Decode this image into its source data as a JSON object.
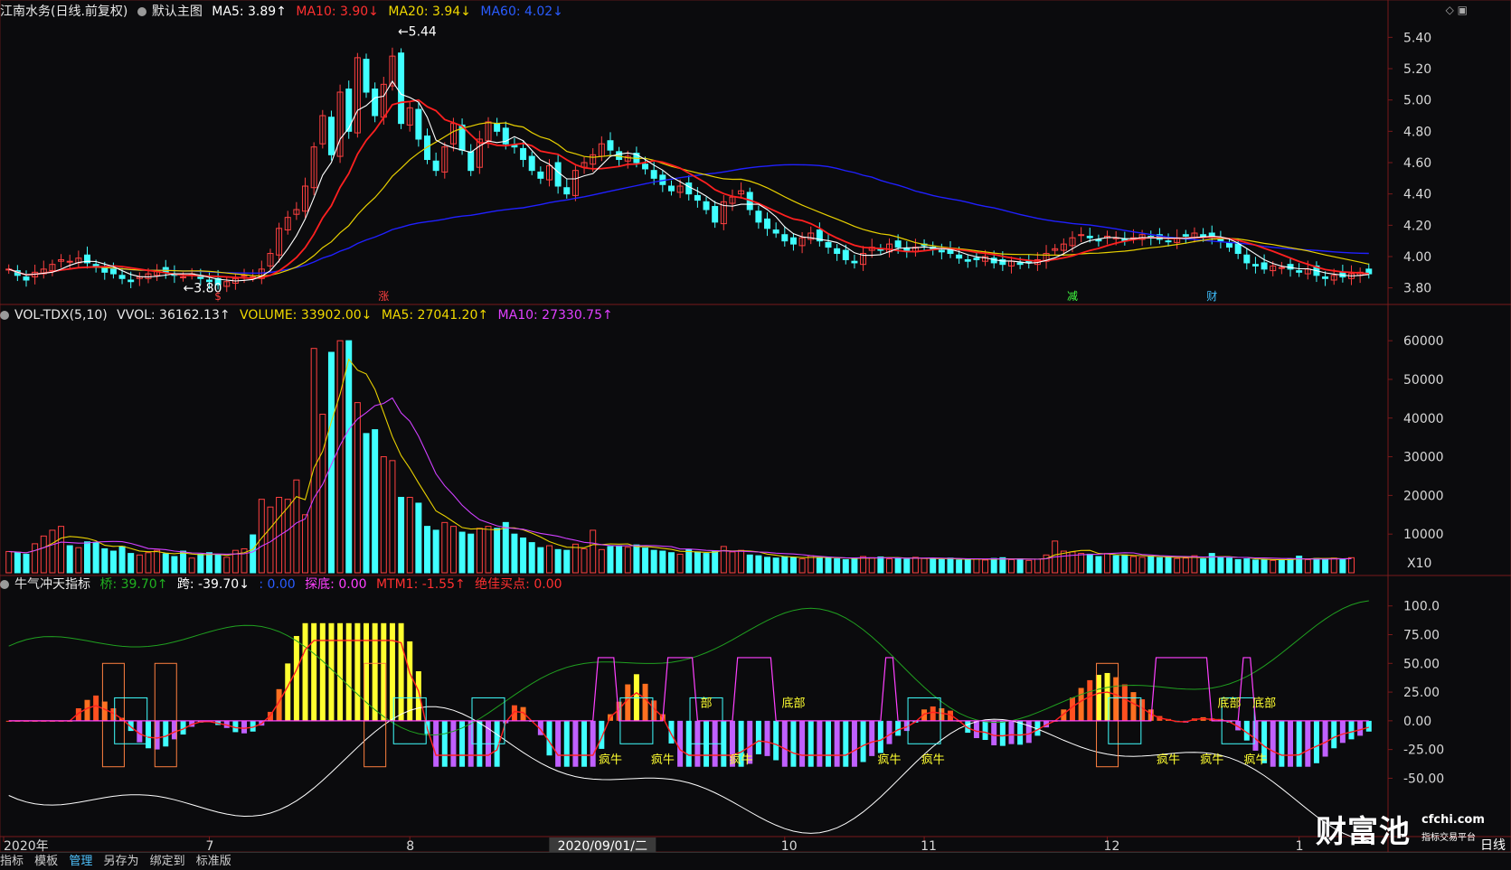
{
  "price_header": {
    "stock": "江南水务(日线.前复权)",
    "main_chart": "默认主图",
    "ma5": "MA5: 3.89↑",
    "ma10": "MA10: 3.90↓",
    "ma20": "MA20: 3.94↓",
    "ma60": "MA60: 4.02↓"
  },
  "vol_header": {
    "name": "VOL-TDX(5,10)",
    "vvol": "VVOL: 36162.13↑",
    "volume": "VOLUME: 33902.00↓",
    "ma5": "MA5: 27041.20↑",
    "ma10": "MA10: 27330.75↑"
  },
  "ind_header": {
    "name": "牛气冲天指标",
    "qiao": "桥: 39.70↑",
    "kua": "跨: -39.70↓",
    "blank": ": 0.00",
    "tandi": "探底: 0.00",
    "mtm1": "MTM1: -1.55↑",
    "best": "绝佳买点: 0.00"
  },
  "colors": {
    "ma5": "#ffffff",
    "ma10": "#ff2020",
    "ma20": "#e8d000",
    "ma60": "#2020ff",
    "up": "#ff4040",
    "down": "#40ffff",
    "vol_ma5": "#e8d000",
    "vol_ma10": "#d040ff",
    "qiao": "#20a020",
    "kua": "#ffffff",
    "mtm_line": "#ff2020",
    "tandi": "#ff40ff"
  },
  "chart_data": [
    {
      "type": "candlestick",
      "name": "price",
      "y_ticks": [
        "5.40",
        "5.20",
        "5.00",
        "4.80",
        "4.60",
        "4.40",
        "4.20",
        "4.00",
        "3.80"
      ],
      "ylim": [
        3.7,
        5.5
      ],
      "high_label": "5.44",
      "low_label": "3.80",
      "events": [
        "$",
        "涨",
        "减",
        "财"
      ],
      "close": [
        3.92,
        3.88,
        3.85,
        3.9,
        3.92,
        3.95,
        3.98,
        3.97,
        3.99,
        3.96,
        3.94,
        3.9,
        3.89,
        3.86,
        3.84,
        3.87,
        3.89,
        3.91,
        3.9,
        3.88,
        3.87,
        3.89,
        3.86,
        3.84,
        3.82,
        3.84,
        3.86,
        3.88,
        3.87,
        3.92,
        4.02,
        4.18,
        4.25,
        4.3,
        4.45,
        4.7,
        4.9,
        4.65,
        5.05,
        4.8,
        5.27,
        5.05,
        4.9,
        5.1,
        5.28,
        4.85,
        4.95,
        4.75,
        4.62,
        4.55,
        4.7,
        4.85,
        4.68,
        4.55,
        4.75,
        4.86,
        4.8,
        4.72,
        4.7,
        4.62,
        4.55,
        4.5,
        4.58,
        4.45,
        4.4,
        4.55,
        4.6,
        4.65,
        4.72,
        4.68,
        4.62,
        4.64,
        4.6,
        4.56,
        4.5,
        4.46,
        4.42,
        4.45,
        4.4,
        4.36,
        4.3,
        4.22,
        4.35,
        4.38,
        4.42,
        4.3,
        4.22,
        4.18,
        4.15,
        4.1,
        4.08,
        4.12,
        4.15,
        4.1,
        4.06,
        4.02,
        3.98,
        3.96,
        4.02,
        4.06,
        4.04,
        4.08,
        4.06,
        4.04,
        4.06,
        4.07,
        4.05,
        4.03,
        4.02,
        3.99,
        3.97,
        3.98,
        4.0,
        3.96,
        3.95,
        3.97,
        3.95,
        3.96,
        3.98,
        4.02,
        4.05,
        4.08,
        4.12,
        4.14,
        4.12,
        4.1,
        4.13,
        4.12,
        4.1,
        4.12,
        4.14,
        4.12,
        4.11,
        4.1,
        4.12,
        4.13,
        4.15,
        4.13,
        4.12,
        4.1,
        4.06,
        4.02,
        3.96,
        3.94,
        3.92,
        3.94,
        3.93,
        3.92,
        3.9,
        3.92,
        3.88,
        3.86,
        3.88,
        3.87,
        3.89,
        3.9,
        3.89
      ]
    },
    {
      "type": "bar",
      "name": "volume",
      "y_ticks": [
        "60000",
        "50000",
        "40000",
        "30000",
        "20000",
        "10000"
      ],
      "unit": "X10",
      "ylim": [
        0,
        64000
      ],
      "values": [
        5500,
        5200,
        4800,
        7500,
        9500,
        11000,
        12000,
        7000,
        6500,
        8000,
        7800,
        6200,
        5600,
        6800,
        5000,
        4600,
        5200,
        5800,
        4900,
        4200,
        5600,
        3800,
        4800,
        5200,
        4600,
        4000,
        5800,
        6200,
        9800,
        19000,
        17000,
        19500,
        19000,
        24000,
        15000,
        58000,
        41000,
        57000,
        60000,
        60000,
        44000,
        36000,
        37000,
        30000,
        29000,
        19500,
        19500,
        18000,
        12000,
        11000,
        13000,
        12000,
        10500,
        10000,
        11500,
        12000,
        11500,
        13000,
        10000,
        9000,
        7800,
        6500,
        7000,
        6000,
        5800,
        7400,
        6200,
        11000,
        6000,
        6800,
        7000,
        6600,
        7200,
        6400,
        5800,
        5600,
        5200,
        4800,
        6000,
        5400,
        5000,
        5600,
        6800,
        5400,
        5800,
        4600,
        4400,
        4000,
        3800,
        4200,
        4000,
        3600,
        4400,
        3800,
        4000,
        3600,
        3400,
        3800,
        4200,
        3900,
        4100,
        3600,
        3800,
        3500,
        4000,
        3700,
        3600,
        3400,
        3800,
        3300,
        3500,
        3600,
        3300,
        3700,
        3900,
        3400,
        3600,
        3200,
        3500,
        4600,
        8200,
        5600,
        5400,
        5000,
        4800,
        4200,
        5000,
        4400,
        4600,
        4200,
        4000,
        4300,
        3900,
        4100,
        3700,
        3800,
        4400,
        3600,
        5000,
        4000,
        3800,
        3400,
        3600,
        3300,
        3500,
        3200,
        3400,
        3600,
        4300,
        3400,
        3700,
        3500,
        3800,
        3600,
        3900
      ]
    },
    {
      "type": "line",
      "name": "牛气冲天指标",
      "y_ticks": [
        "100.0",
        "75.00",
        "50.00",
        "25.00",
        "0.00",
        "-25.00",
        "-50.00"
      ],
      "ylim": [
        -100,
        110
      ],
      "labels": [
        "疯牛",
        "底部",
        "部"
      ]
    }
  ],
  "x_axis": {
    "labels": [
      "2020年",
      "7",
      "8",
      "10",
      "11",
      "12",
      "1"
    ],
    "cursor_label": "2020/09/01/二"
  },
  "toolbar": {
    "items": [
      "指标",
      "模板",
      "管理",
      "另存为",
      "绑定到",
      "标准版"
    ],
    "period": "日线"
  },
  "watermark": {
    "cn": "财富池",
    "site": "cfchi.com",
    "sub": "指标交易平台"
  }
}
